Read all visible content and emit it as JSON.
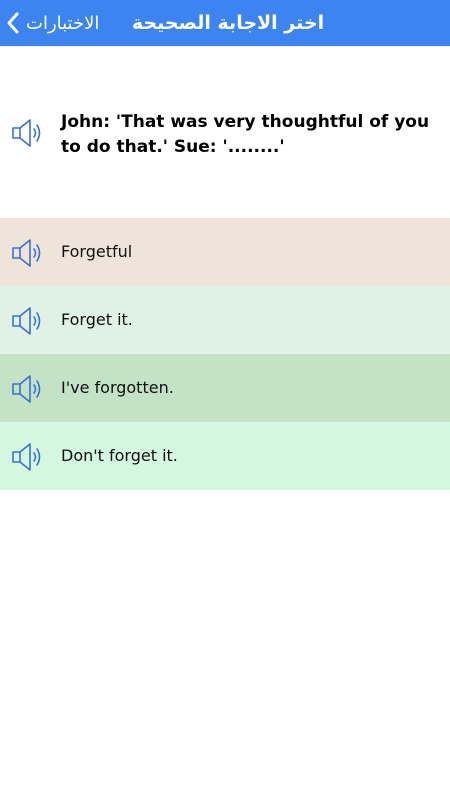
{
  "header": {
    "back_label": "الاختبارات",
    "title": "اختر الاجابة الصحيحة"
  },
  "question": {
    "text": "John: 'That was very thoughtful of you to do that.' Sue: '........'",
    "icon": "speaker-icon"
  },
  "options": [
    {
      "label": "Forgetful",
      "bg": "#efe4da"
    },
    {
      "label": "Forget it.",
      "bg": "#e0f1e6"
    },
    {
      "label": "I've forgotten.",
      "bg": "#c4e2c5"
    },
    {
      "label": "Don't forget it.",
      "bg": "#d4f8df"
    }
  ],
  "colors": {
    "header_bg": "#3c85f0",
    "icon_color": "#3c6fd6"
  }
}
